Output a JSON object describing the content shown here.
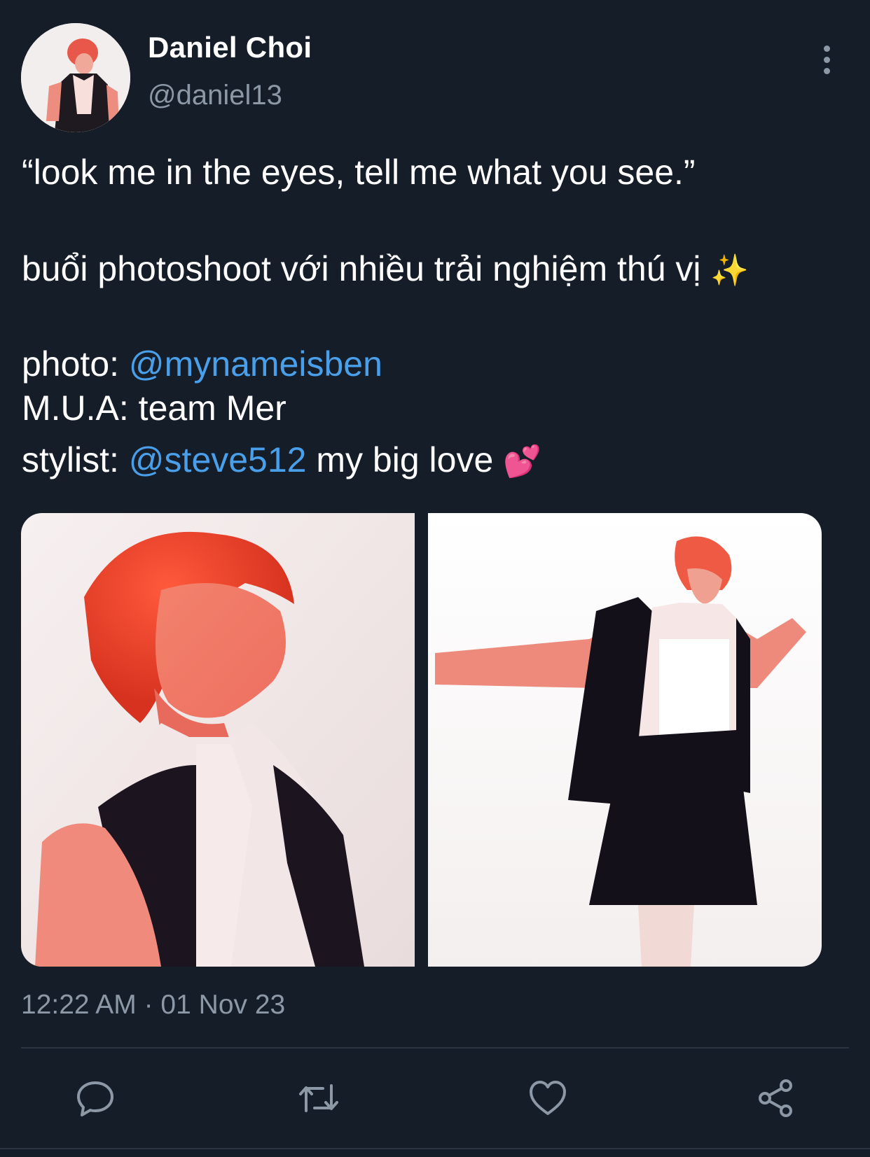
{
  "author": {
    "display_name": "Daniel Choi",
    "handle": "@daniel13"
  },
  "tweet": {
    "line1": "“look me in the eyes, tell me what you see.”",
    "line2_text": "buổi photoshoot với nhiều trải nghiệm thú vị",
    "line2_emoji": "✨",
    "photo_label": "photo: ",
    "photo_mention": "@mynameisben",
    "mua_line": "M.U.A: team Mer",
    "stylist_label": "stylist: ",
    "stylist_mention": "@steve512",
    "stylist_suffix": " my big love",
    "stylist_emoji": "💕"
  },
  "timestamp": "12:22 AM · 01 Nov 23",
  "actions": [
    "reply-icon",
    "retweet-icon",
    "like-icon",
    "share-icon"
  ],
  "colors": {
    "background": "#151d28",
    "text": "#ffffff",
    "secondary": "#8c98a6",
    "mention": "#4a9fea",
    "divider": "#2b3541"
  }
}
